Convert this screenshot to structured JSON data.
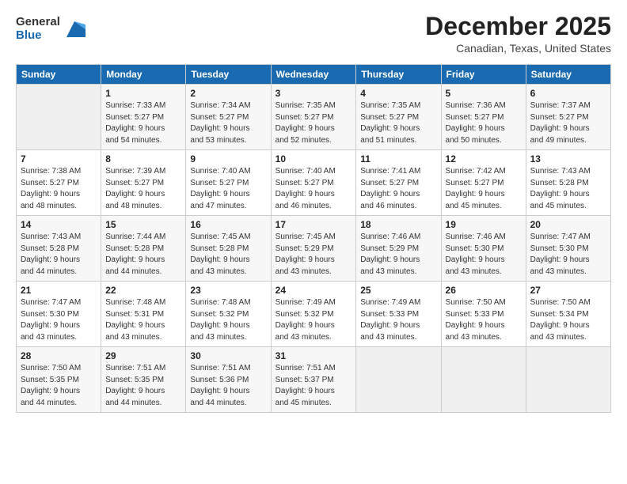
{
  "logo": {
    "general": "General",
    "blue": "Blue"
  },
  "title": "December 2025",
  "location": "Canadian, Texas, United States",
  "days_header": [
    "Sunday",
    "Monday",
    "Tuesday",
    "Wednesday",
    "Thursday",
    "Friday",
    "Saturday"
  ],
  "weeks": [
    [
      {
        "day": "",
        "info": ""
      },
      {
        "day": "1",
        "info": "Sunrise: 7:33 AM\nSunset: 5:27 PM\nDaylight: 9 hours\nand 54 minutes."
      },
      {
        "day": "2",
        "info": "Sunrise: 7:34 AM\nSunset: 5:27 PM\nDaylight: 9 hours\nand 53 minutes."
      },
      {
        "day": "3",
        "info": "Sunrise: 7:35 AM\nSunset: 5:27 PM\nDaylight: 9 hours\nand 52 minutes."
      },
      {
        "day": "4",
        "info": "Sunrise: 7:35 AM\nSunset: 5:27 PM\nDaylight: 9 hours\nand 51 minutes."
      },
      {
        "day": "5",
        "info": "Sunrise: 7:36 AM\nSunset: 5:27 PM\nDaylight: 9 hours\nand 50 minutes."
      },
      {
        "day": "6",
        "info": "Sunrise: 7:37 AM\nSunset: 5:27 PM\nDaylight: 9 hours\nand 49 minutes."
      }
    ],
    [
      {
        "day": "7",
        "info": "Sunrise: 7:38 AM\nSunset: 5:27 PM\nDaylight: 9 hours\nand 48 minutes."
      },
      {
        "day": "8",
        "info": "Sunrise: 7:39 AM\nSunset: 5:27 PM\nDaylight: 9 hours\nand 48 minutes."
      },
      {
        "day": "9",
        "info": "Sunrise: 7:40 AM\nSunset: 5:27 PM\nDaylight: 9 hours\nand 47 minutes."
      },
      {
        "day": "10",
        "info": "Sunrise: 7:40 AM\nSunset: 5:27 PM\nDaylight: 9 hours\nand 46 minutes."
      },
      {
        "day": "11",
        "info": "Sunrise: 7:41 AM\nSunset: 5:27 PM\nDaylight: 9 hours\nand 46 minutes."
      },
      {
        "day": "12",
        "info": "Sunrise: 7:42 AM\nSunset: 5:27 PM\nDaylight: 9 hours\nand 45 minutes."
      },
      {
        "day": "13",
        "info": "Sunrise: 7:43 AM\nSunset: 5:28 PM\nDaylight: 9 hours\nand 45 minutes."
      }
    ],
    [
      {
        "day": "14",
        "info": "Sunrise: 7:43 AM\nSunset: 5:28 PM\nDaylight: 9 hours\nand 44 minutes."
      },
      {
        "day": "15",
        "info": "Sunrise: 7:44 AM\nSunset: 5:28 PM\nDaylight: 9 hours\nand 44 minutes."
      },
      {
        "day": "16",
        "info": "Sunrise: 7:45 AM\nSunset: 5:28 PM\nDaylight: 9 hours\nand 43 minutes."
      },
      {
        "day": "17",
        "info": "Sunrise: 7:45 AM\nSunset: 5:29 PM\nDaylight: 9 hours\nand 43 minutes."
      },
      {
        "day": "18",
        "info": "Sunrise: 7:46 AM\nSunset: 5:29 PM\nDaylight: 9 hours\nand 43 minutes."
      },
      {
        "day": "19",
        "info": "Sunrise: 7:46 AM\nSunset: 5:30 PM\nDaylight: 9 hours\nand 43 minutes."
      },
      {
        "day": "20",
        "info": "Sunrise: 7:47 AM\nSunset: 5:30 PM\nDaylight: 9 hours\nand 43 minutes."
      }
    ],
    [
      {
        "day": "21",
        "info": "Sunrise: 7:47 AM\nSunset: 5:30 PM\nDaylight: 9 hours\nand 43 minutes."
      },
      {
        "day": "22",
        "info": "Sunrise: 7:48 AM\nSunset: 5:31 PM\nDaylight: 9 hours\nand 43 minutes."
      },
      {
        "day": "23",
        "info": "Sunrise: 7:48 AM\nSunset: 5:32 PM\nDaylight: 9 hours\nand 43 minutes."
      },
      {
        "day": "24",
        "info": "Sunrise: 7:49 AM\nSunset: 5:32 PM\nDaylight: 9 hours\nand 43 minutes."
      },
      {
        "day": "25",
        "info": "Sunrise: 7:49 AM\nSunset: 5:33 PM\nDaylight: 9 hours\nand 43 minutes."
      },
      {
        "day": "26",
        "info": "Sunrise: 7:50 AM\nSunset: 5:33 PM\nDaylight: 9 hours\nand 43 minutes."
      },
      {
        "day": "27",
        "info": "Sunrise: 7:50 AM\nSunset: 5:34 PM\nDaylight: 9 hours\nand 43 minutes."
      }
    ],
    [
      {
        "day": "28",
        "info": "Sunrise: 7:50 AM\nSunset: 5:35 PM\nDaylight: 9 hours\nand 44 minutes."
      },
      {
        "day": "29",
        "info": "Sunrise: 7:51 AM\nSunset: 5:35 PM\nDaylight: 9 hours\nand 44 minutes."
      },
      {
        "day": "30",
        "info": "Sunrise: 7:51 AM\nSunset: 5:36 PM\nDaylight: 9 hours\nand 44 minutes."
      },
      {
        "day": "31",
        "info": "Sunrise: 7:51 AM\nSunset: 5:37 PM\nDaylight: 9 hours\nand 45 minutes."
      },
      {
        "day": "",
        "info": ""
      },
      {
        "day": "",
        "info": ""
      },
      {
        "day": "",
        "info": ""
      }
    ]
  ]
}
